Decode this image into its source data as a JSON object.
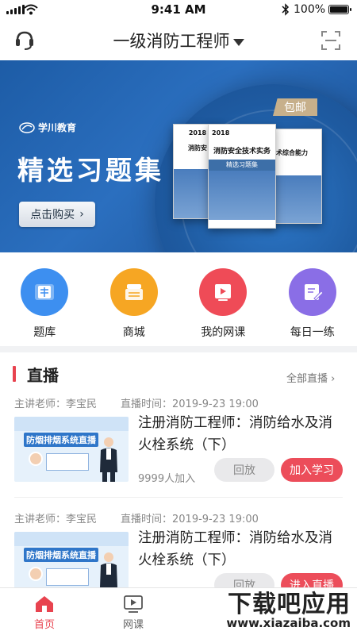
{
  "status_bar": {
    "time": "9:41 AM",
    "battery": "100%"
  },
  "nav": {
    "title": "一级消防工程师"
  },
  "banner": {
    "brand": "学川教育",
    "headline": "精选习题集",
    "buy_label": "点击购买",
    "ribbon": "包邮",
    "book_center_title": "消防安全技术实务",
    "book_center_sub": "精选习题集",
    "book_left_title": "消防安",
    "book_right_title": "术综合能力",
    "book_year": "2018"
  },
  "categories": [
    {
      "label": "题库",
      "color": "#3d8ff0",
      "icon": "question-bank-icon"
    },
    {
      "label": "商城",
      "color": "#f6a623",
      "icon": "store-icon"
    },
    {
      "label": "我的网课",
      "color": "#ef4b57",
      "icon": "my-course-icon"
    },
    {
      "label": "每日一练",
      "color": "#8a6ee6",
      "icon": "daily-practice-icon"
    }
  ],
  "live": {
    "title": "直播",
    "more_label": "全部直播",
    "courses": [
      {
        "teacher": "主讲老师：李宝民",
        "time": "直播时间：2019-9-23 19:00",
        "title": "注册消防工程师：消防给水及消火栓系统（下）",
        "count": "9999人加入",
        "replay": "回放",
        "join": "加入学习",
        "thumb_title": "防烟排烟系统直播"
      },
      {
        "teacher": "主讲老师：李宝民",
        "time": "直播时间：2019-9-23 19:00",
        "title": "注册消防工程师：消防给水及消火栓系统（下）",
        "count": "",
        "replay": "回放",
        "join": "进入直播",
        "thumb_title": "防烟排烟系统直播"
      }
    ]
  },
  "tabs": [
    {
      "label": "首页",
      "icon": "home-icon",
      "active": true
    },
    {
      "label": "网课",
      "icon": "video-icon",
      "active": false
    }
  ],
  "watermark": {
    "main": "下载吧应用",
    "url": "www.xiazaiba.com"
  },
  "colors": {
    "accent": "#e8434f",
    "banner_blue": "#2b6fbf"
  }
}
